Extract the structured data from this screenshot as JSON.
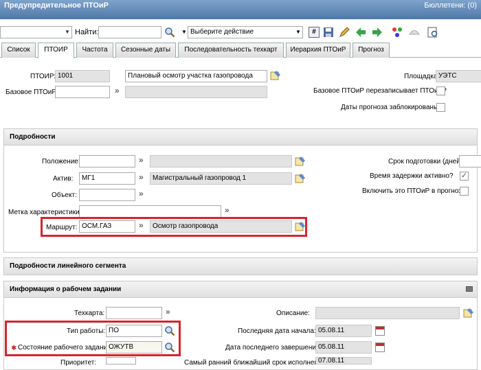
{
  "titlebar": {
    "title": "Предупредительное ПТОиР",
    "bulletins": "Бюллетени: (0)"
  },
  "toolbar": {
    "find_label": "Найти:",
    "action_select": "Выберите действие"
  },
  "tabs": [
    {
      "label": "Список"
    },
    {
      "label": "ПТОИР"
    },
    {
      "label": "Частота"
    },
    {
      "label": "Сезонные даты"
    },
    {
      "label": "Последовательность техкарт"
    },
    {
      "label": "Иерархия ПТОиР"
    },
    {
      "label": "Прогноз"
    }
  ],
  "header": {
    "ptoir_label": "ПТОИР:",
    "ptoir_value": "1001",
    "ptoir_desc": "Плановый осмотр участка газопровода",
    "base_label": "Базовое ПТОиР:",
    "site_label": "Площадка:",
    "site_value": "УЭТС",
    "overwrite_label": "Базовое ПТОиР перезаписывает ПТОиР?",
    "locked_label": "Даты прогноза заблокированы?"
  },
  "details": {
    "title": "Подробности",
    "position_label": "Положение:",
    "asset_label": "Актив:",
    "asset_value": "МГ1",
    "asset_desc": "Магистральный газопровод 1",
    "object_label": "Объект:",
    "feature_label": "Метка характеристики:",
    "route_label": "Маршрут:",
    "route_value": "ОСМ.ГАЗ",
    "route_desc": "Осмотр газопровода",
    "lead_label": "Срок подготовки (дней):",
    "delay_label": "Время задержки активно?",
    "include_label": "Включить это ПТОиР в прогноз?"
  },
  "linear": {
    "title": "Подробности линейного сегмента"
  },
  "workorder": {
    "title": "Информация о рабочем задании",
    "jobplan_label": "Техкарта:",
    "worktype_label": "Тип работы:",
    "worktype_value": "ПО",
    "status_label": "Состояние рабочего задания:",
    "status_value": "ОЖУТВ",
    "priority_label": "Приоритет:",
    "desc_label": "Описание:",
    "laststart_label": "Последняя дата начала:",
    "laststart_value": "05.08.11",
    "lastend_label": "Дата последнего завершения:",
    "lastend_value": "05.08.11",
    "earliest_label": "Самый ранний ближайший срок исполнения:",
    "earliest_value": "07.08.11"
  }
}
